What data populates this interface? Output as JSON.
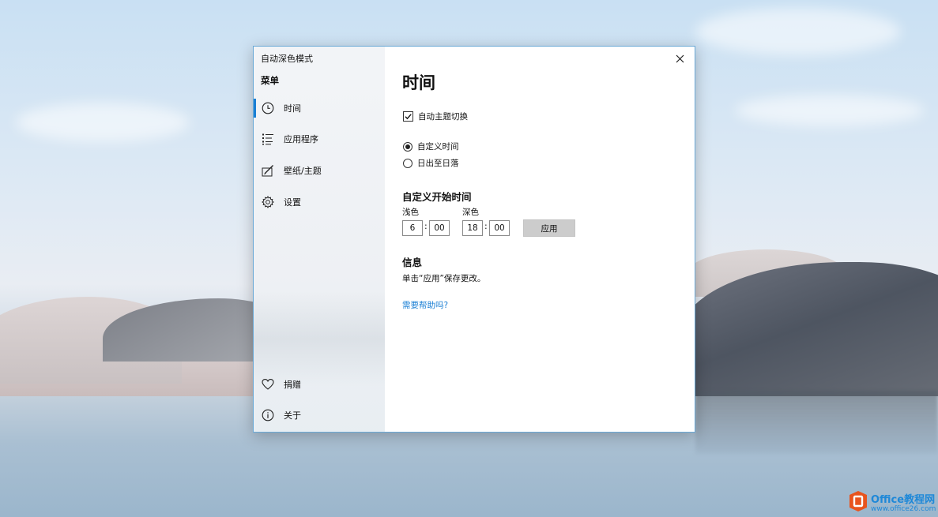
{
  "window": {
    "app_title": "自动深色模式",
    "close_label": "×"
  },
  "sidebar": {
    "menu_heading": "菜单",
    "items": [
      {
        "label": "时间",
        "icon": "clock-icon",
        "selected": true
      },
      {
        "label": "应用程序",
        "icon": "list-icon",
        "selected": false
      },
      {
        "label": "壁纸/主题",
        "icon": "paint-icon",
        "selected": false
      },
      {
        "label": "设置",
        "icon": "gear-icon",
        "selected": false
      }
    ],
    "bottom_items": [
      {
        "label": "捐赠",
        "icon": "heart-icon"
      },
      {
        "label": "关于",
        "icon": "info-icon"
      }
    ]
  },
  "main": {
    "page_title": "时间",
    "auto_switch": {
      "label": "自动主题切换",
      "checked": true
    },
    "mode_options": [
      {
        "label": "自定义时间",
        "selected": true
      },
      {
        "label": "日出至日落",
        "selected": false
      }
    ],
    "custom_start": {
      "title": "自定义开始时间",
      "light": {
        "label": "浅色",
        "hour": "6",
        "minute": "00"
      },
      "dark": {
        "label": "深色",
        "hour": "18",
        "minute": "00"
      },
      "separator": ":",
      "apply_label": "应用"
    },
    "info": {
      "title": "信息",
      "text": "单击“应用”保存更改。"
    },
    "help_link": "需要帮助吗?"
  },
  "watermark": {
    "title": "Office教程网",
    "url": "www.office26.com"
  },
  "colors": {
    "accent": "#1a7fd4",
    "window_border": "#6aa9d6",
    "apply_button": "#cccccc",
    "watermark_orange": "#e8541e"
  }
}
